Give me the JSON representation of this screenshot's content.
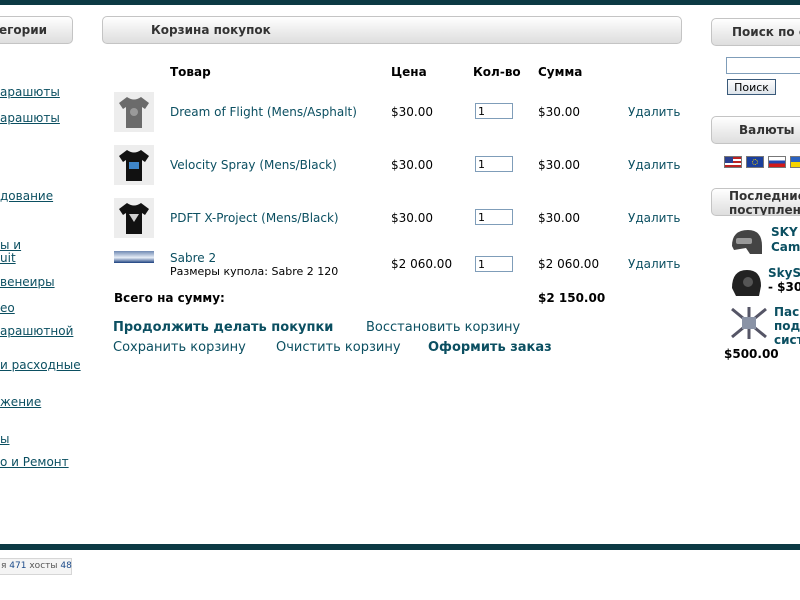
{
  "left": {
    "heading": "егории",
    "links": [
      "арашюты",
      "арашюты",
      "дование",
      "ы и",
      "uit",
      "венеиры",
      "ео",
      "арашютной",
      "и расходные",
      "жение",
      "ы",
      "о и Ремонт"
    ]
  },
  "cart": {
    "heading": "Корзина покупок",
    "columns": {
      "product": "Товар",
      "price": "Цена",
      "qty": "Кол-во",
      "sum": "Сумма"
    },
    "items": [
      {
        "name": "Dream of Flight (Mens/Asphalt)",
        "sub": "",
        "price": "$30.00",
        "qty": "1",
        "sum": "$30.00",
        "remove": "Удалить",
        "thumb": "tshirt-gray-icon"
      },
      {
        "name": "Velocity Spray (Mens/Black)",
        "sub": "",
        "price": "$30.00",
        "qty": "1",
        "sum": "$30.00",
        "remove": "Удалить",
        "thumb": "tshirt-black-icon"
      },
      {
        "name": "PDFT X-Project (Mens/Black)",
        "sub": "",
        "price": "$30.00",
        "qty": "1",
        "sum": "$30.00",
        "remove": "Удалить",
        "thumb": "tshirt-black-icon"
      },
      {
        "name": "Sabre 2",
        "sub": "Размеры купола: Sabre 2 120",
        "price": "$2 060.00",
        "qty": "1",
        "sum": "$2 060.00",
        "remove": "Удалить",
        "thumb": "canopy-banner-icon"
      }
    ],
    "total_label": "Всего на сумму:",
    "total_value": "$2 150.00",
    "actions": {
      "continue": "Продолжить делать покупки",
      "restore": "Восстановить корзину",
      "save": "Сохранить корзину",
      "clear": "Очистить корзину",
      "checkout": "Оформить заказ"
    }
  },
  "right": {
    "search_heading": "Поиск по с",
    "search_button": "Поиск",
    "currency_heading": "Валюты",
    "currency_flags": [
      "usa-flag-icon",
      "eu-flag-icon",
      "russia-flag-icon",
      "ukraine-flag-icon"
    ],
    "new_heading": "Последние поступлен",
    "new_items": [
      {
        "line1": "SKY",
        "line2": "Cam",
        "price": ""
      },
      {
        "line1": "SkyS",
        "line2": "- $30",
        "price": ""
      },
      {
        "line1": "Пас",
        "line2": "под",
        "line3": "сист",
        "price": "$500.00"
      }
    ]
  },
  "footer": {
    "counter_prefix": "я",
    "hits": "471",
    "hosts_label": "хосты",
    "hosts": "48"
  },
  "colors": {
    "link": "#0b4f61",
    "bar": "#0c3a44"
  }
}
